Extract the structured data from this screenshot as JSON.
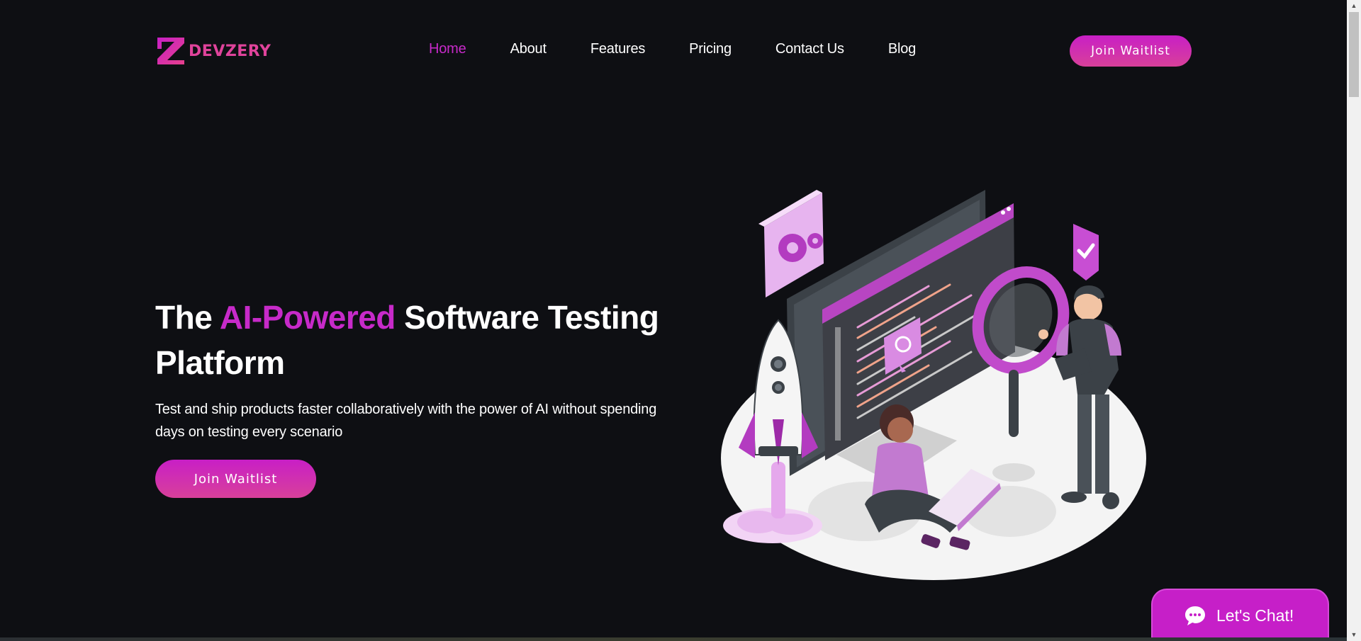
{
  "header": {
    "logo_text": "DEVZERY",
    "nav": [
      {
        "label": "Home",
        "active": true
      },
      {
        "label": "About",
        "active": false
      },
      {
        "label": "Features",
        "active": false
      },
      {
        "label": "Pricing",
        "active": false
      },
      {
        "label": "Contact Us",
        "active": false
      },
      {
        "label": "Blog",
        "active": false
      }
    ],
    "cta_label": "Join Waitlist"
  },
  "hero": {
    "title_part1": "The ",
    "title_accent": "AI-Powered",
    "title_part2": " Software Testing Platform",
    "subtitle": "Test and ship products faster collaboratively with the power of AI without spending days on testing every scenario",
    "cta_label": "Join Waitlist"
  },
  "chat": {
    "label": "Let's Chat!",
    "icon": "chat-bubble-icon"
  },
  "colors": {
    "background": "#0e0f13",
    "accent": "#c72ac9",
    "brand_pink": "#e0439b",
    "button_gradient_start": "#c81fc6",
    "button_gradient_end": "#d8409a"
  }
}
